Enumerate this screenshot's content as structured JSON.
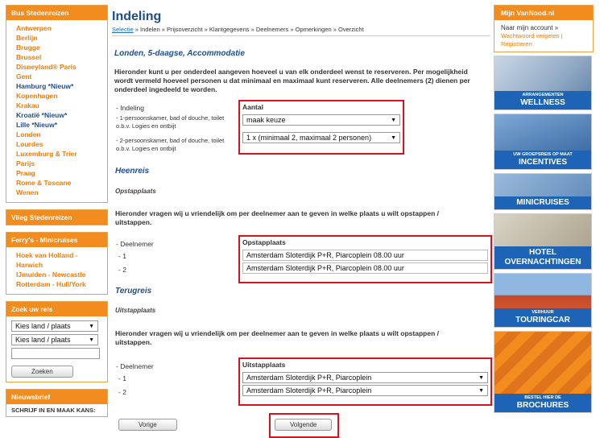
{
  "left": {
    "bus_head": "Bus Stedenreizen",
    "cities": [
      {
        "label": "Antwerpen",
        "hl": false
      },
      {
        "label": "Berlijn",
        "hl": false
      },
      {
        "label": "Brugge",
        "hl": false
      },
      {
        "label": "Brussel",
        "hl": false
      },
      {
        "label": "Disneyland® Paris",
        "hl": false
      },
      {
        "label": "Gent",
        "hl": false
      },
      {
        "label": "Hamburg *Nieuw*",
        "hl": true
      },
      {
        "label": "Kopenhagen",
        "hl": false
      },
      {
        "label": "Krakau",
        "hl": false
      },
      {
        "label": "Kroatië *Nieuw*",
        "hl": true
      },
      {
        "label": "Lille *Nieuw*",
        "hl": true
      },
      {
        "label": "Londen",
        "hl": false
      },
      {
        "label": "Lourdes",
        "hl": false
      },
      {
        "label": "Luxemburg & Trier",
        "hl": false
      },
      {
        "label": "Parijs",
        "hl": false
      },
      {
        "label": "Praag",
        "hl": false
      },
      {
        "label": "Rome & Toscane",
        "hl": false
      },
      {
        "label": "Wenen",
        "hl": false
      }
    ],
    "vlieg_head": "Vlieg Stedenreizen",
    "ferry_head": "Ferry's - Minicruises",
    "ferries": [
      "Hoek van Holland -",
      "Harwich",
      "IJmuiden - Newcastle",
      "Rotterdam - Hull/York"
    ],
    "search_head": "Zoek uw reis",
    "search_select1": "Kies land / plaats",
    "search_select2": "Kies land / plaats",
    "search_button": "Zoeken",
    "news_head": "Nieuwsbrief",
    "news_text": "SCHRIJF IN EN MAAK KANS:"
  },
  "main": {
    "title": "Indeling",
    "crumbs": {
      "first": "Selectie",
      "rest": " » Indelen » Prijsoverzicht » Klantgegevens » Deelnemers » Opmerkingen » Overzicht"
    },
    "subtitle": "Londen, 5-daagse, Accommodatie",
    "intro": "Hieronder kunt u per onderdeel aangeven hoeveel u van elk onderdeel wenst te reserveren. Per mogelijkheid wordt vermeld hoeveel personen u dat minimaal en maximaal kunt reserveren. Alle deelnemers (2) dienen per onderdeel ingedeeld te worden.",
    "indeling": {
      "label": "- Indeling",
      "room1": "- 1-persoonskamer, bad of douche, toilet o.b.v. Logies en ontbijt",
      "room2": "- 2-persoonskamer, bad of douche, toilet o.b.v. Logies en ontbijt",
      "aantal_label": "Aantal",
      "select1": "maak keuze",
      "select2": "1 x (minimaal 2, maximaal 2 personen)"
    },
    "heenreis": {
      "title": "Heenreis",
      "sub": "Opstapplaats",
      "text": "Hieronder vragen wij u vriendelijk om per deelnemer aan te geven in welke plaats u wilt opstappen / uitstappen.",
      "deelnemer_label": "- Deelnemer",
      "n1": "- 1",
      "n2": "- 2",
      "box_label": "Opstapplaats",
      "value1": "Amsterdam Sloterdijk P+R, Piarcoplein 08.00 uur",
      "value2": "Amsterdam Sloterdijk P+R, Piarcoplein 08.00 uur"
    },
    "terugreis": {
      "title": "Terugreis",
      "sub": "Uitstapplaats",
      "text": "Hieronder vragen wij u vriendelijk om per deelnemer aan te geven in welke plaats u wilt opstappen / uitstappen.",
      "deelnemer_label": "- Deelnemer",
      "n1": "- 1",
      "n2": "- 2",
      "box_label": "Uitstapplaats",
      "value1": "Amsterdam Sloterdijk P+R, Piarcoplein",
      "value2": "Amsterdam Sloterdijk P+R, Piarcoplein"
    },
    "prev_button": "Vorige",
    "next_button": "Volgende"
  },
  "right": {
    "account_head": "Mijn VanNood.nl",
    "account_link": "Naar mijn account »",
    "password_link": "Wachtwoord vergeten | Registreren",
    "banners": [
      {
        "title": "WELLNESS",
        "sub": "ARRANGEMENTEN",
        "color": "#1d64b7"
      },
      {
        "title": "INCENTIVES",
        "sub": "UW GROEPSREIS OP MAAT",
        "color": "#1d64b7"
      },
      {
        "title": "MINICRUISES",
        "sub": "",
        "color": "#1d64b7"
      },
      {
        "title": "HOTEL OVERNACHTINGEN",
        "sub": "",
        "color": "#1d64b7"
      },
      {
        "title": "TOURINGCAR",
        "sub": "VERHUUR",
        "color": "#1d64b7"
      },
      {
        "title": "BROCHURES",
        "sub": "BESTEL HIER DE",
        "color": "#1d64b7"
      }
    ]
  },
  "colors": {
    "orange": "#f28c1e",
    "blue": "#1f4e8c",
    "red": "#d7141d"
  }
}
